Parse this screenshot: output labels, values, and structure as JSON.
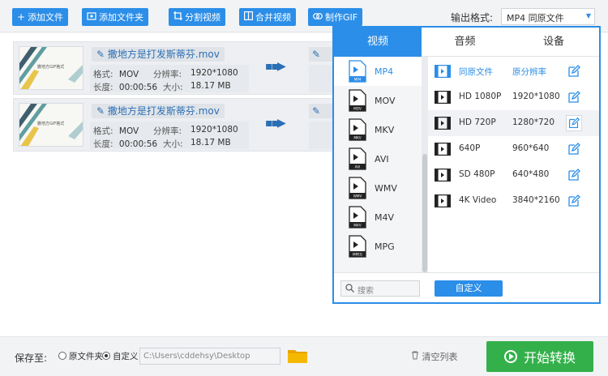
{
  "toolbar": {
    "add_file": "添加文件",
    "add_folder": "添加文件夹",
    "split_video": "分割视频",
    "merge_video": "合并视频",
    "make_gif": "制作GIF",
    "output_format_label": "输出格式:",
    "output_format_value": "MP4  同原文件"
  },
  "files": [
    {
      "name": "撒地方是打发斯蒂芬.mov",
      "format_key": "格式:",
      "format": "MOV",
      "resolution_key": "分辨率:",
      "resolution": "1920*1080",
      "duration_key": "长度:",
      "duration": "00:00:56",
      "size_key": "大小:",
      "size": "18.17 MB"
    },
    {
      "name": "撒地方是打发斯蒂芬.mov",
      "format_key": "格式:",
      "format": "MOV",
      "resolution_key": "分辨率:",
      "resolution": "1920*1080",
      "duration_key": "长度:",
      "duration": "00:00:56",
      "size_key": "大小:",
      "size": "18.17 MB"
    }
  ],
  "popup": {
    "tabs": [
      "视频",
      "音频",
      "设备"
    ],
    "formats": [
      "MP4",
      "MOV",
      "MKV",
      "AVI",
      "WMV",
      "M4V",
      "MPG"
    ],
    "format_badges": [
      "MP4",
      "MOV",
      "MKV",
      "AVI",
      "WMV",
      "M4V",
      "MPEG"
    ],
    "resolutions": [
      {
        "name": "同原文件",
        "value": "原分辨率"
      },
      {
        "name": "HD 1080P",
        "value": "1920*1080"
      },
      {
        "name": "HD 720P",
        "value": "1280*720"
      },
      {
        "name": "640P",
        "value": "960*640"
      },
      {
        "name": "SD 480P",
        "value": "640*480"
      },
      {
        "name": "4K Video",
        "value": "3840*2160"
      }
    ],
    "search_placeholder": "搜索",
    "custom_button": "自定义"
  },
  "bottom": {
    "save_to": "保存至:",
    "option_original": "原文件夹",
    "option_custom": "自定义",
    "path": "C:\\Users\\cddehsy\\Desktop",
    "clear_list": "清空列表",
    "start": "开始转换"
  },
  "colors": {
    "accent": "#2b8ee8",
    "start_green": "#34b04b"
  }
}
